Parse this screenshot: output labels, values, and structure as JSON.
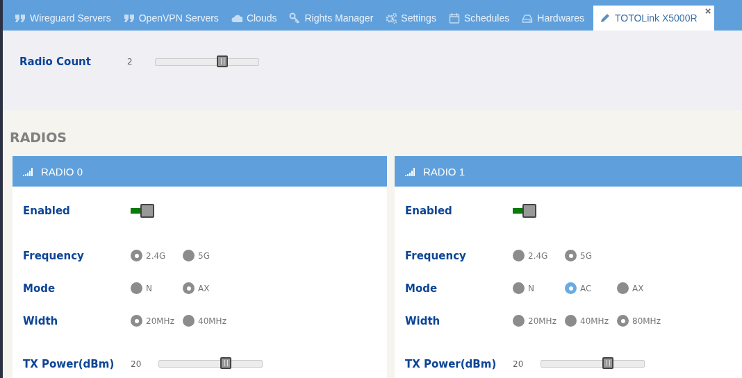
{
  "tabs": [
    {
      "label": "Wireguard Servers",
      "selected": false
    },
    {
      "label": "OpenVPN Servers",
      "selected": false
    },
    {
      "label": "Clouds",
      "selected": false
    },
    {
      "label": "Rights Manager",
      "selected": false
    },
    {
      "label": "Settings",
      "selected": false
    },
    {
      "label": "Schedules",
      "selected": false
    },
    {
      "label": "Hardwares",
      "selected": false
    },
    {
      "label": "TOTOLink X5000R",
      "selected": true,
      "close": "×"
    }
  ],
  "radio_count": {
    "label": "Radio Count",
    "reading": "2",
    "level": 0.65
  },
  "section_title": "RADIOS",
  "radios": [
    {
      "title": "RADIO 0",
      "enabled": {
        "label": "Enabled",
        "on": true
      },
      "groups": [
        {
          "label": "Frequency",
          "options": [
            {
              "label": "2.4G",
              "selected": true,
              "color": "#8c8c8c"
            },
            {
              "label": "5G",
              "selected": false,
              "color": "#8c8c8c"
            }
          ]
        },
        {
          "label": "Mode",
          "options": [
            {
              "label": "N",
              "selected": false,
              "color": "#8c8c8c"
            },
            {
              "label": "AX",
              "selected": true,
              "color": "#8c8c8c"
            }
          ]
        },
        {
          "label": "Width",
          "options": [
            {
              "label": "20MHz",
              "selected": true,
              "color": "#8c8c8c"
            },
            {
              "label": "40MHz",
              "selected": false,
              "color": "#8c8c8c"
            }
          ]
        }
      ],
      "tx_power": {
        "label": "TX Power(dBm)",
        "reading": "20",
        "level": 0.65
      }
    },
    {
      "title": "RADIO 1",
      "enabled": {
        "label": "Enabled",
        "on": true
      },
      "groups": [
        {
          "label": "Frequency",
          "options": [
            {
              "label": "2.4G",
              "selected": false,
              "color": "#8c8c8c"
            },
            {
              "label": "5G",
              "selected": true,
              "color": "#8c8c8c"
            }
          ]
        },
        {
          "label": "Mode",
          "options": [
            {
              "label": "N",
              "selected": false,
              "color": "#8c8c8c"
            },
            {
              "label": "AC",
              "selected": true,
              "color": "#6aaae2"
            },
            {
              "label": "AX",
              "selected": false,
              "color": "#8c8c8c"
            }
          ]
        },
        {
          "label": "Width",
          "options": [
            {
              "label": "20MHz",
              "selected": false,
              "color": "#8c8c8c"
            },
            {
              "label": "40MHz",
              "selected": false,
              "color": "#8c8c8c"
            },
            {
              "label": "80MHz",
              "selected": true,
              "color": "#8c8c8c"
            }
          ]
        }
      ],
      "tx_power": {
        "label": "TX Power(dBm)",
        "reading": "20",
        "level": 0.65
      }
    }
  ]
}
